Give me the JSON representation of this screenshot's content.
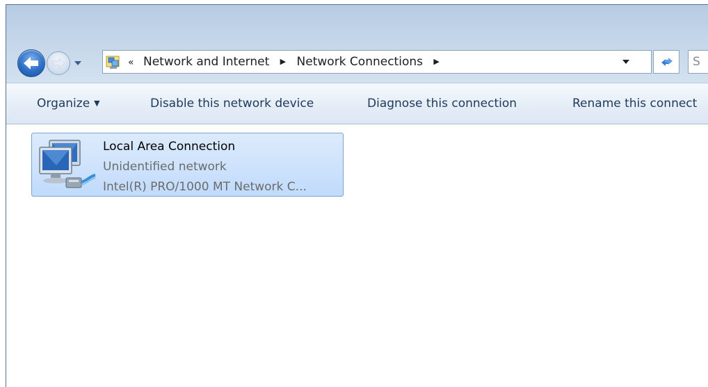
{
  "navigation": {
    "back_icon": "back-arrow-icon",
    "forward_icon": "forward-arrow-icon",
    "history_icon": "chevron-down-icon"
  },
  "address_bar": {
    "icon": "network-connections-icon",
    "overflow_chevron": "«",
    "crumbs": [
      "Network and Internet",
      "Network Connections"
    ],
    "separator": "▶",
    "dropdown_icon": "chevron-down-icon"
  },
  "refresh": {
    "icon": "refresh-icon"
  },
  "search": {
    "placeholder": "S"
  },
  "command_bar": {
    "organize": "Organize",
    "disable": "Disable this network device",
    "diagnose": "Diagnose this connection",
    "rename": "Rename this connect"
  },
  "connections": [
    {
      "name": "Local Area Connection",
      "status": "Unidentified network",
      "device": "Intel(R) PRO/1000 MT Network C...",
      "icon": "network-adapter-icon"
    }
  ],
  "colors": {
    "title_gradient": "#c4d6ea",
    "command_text": "#1e395b",
    "selection": "#c1dbfc",
    "selection_border": "#7da2ce"
  }
}
